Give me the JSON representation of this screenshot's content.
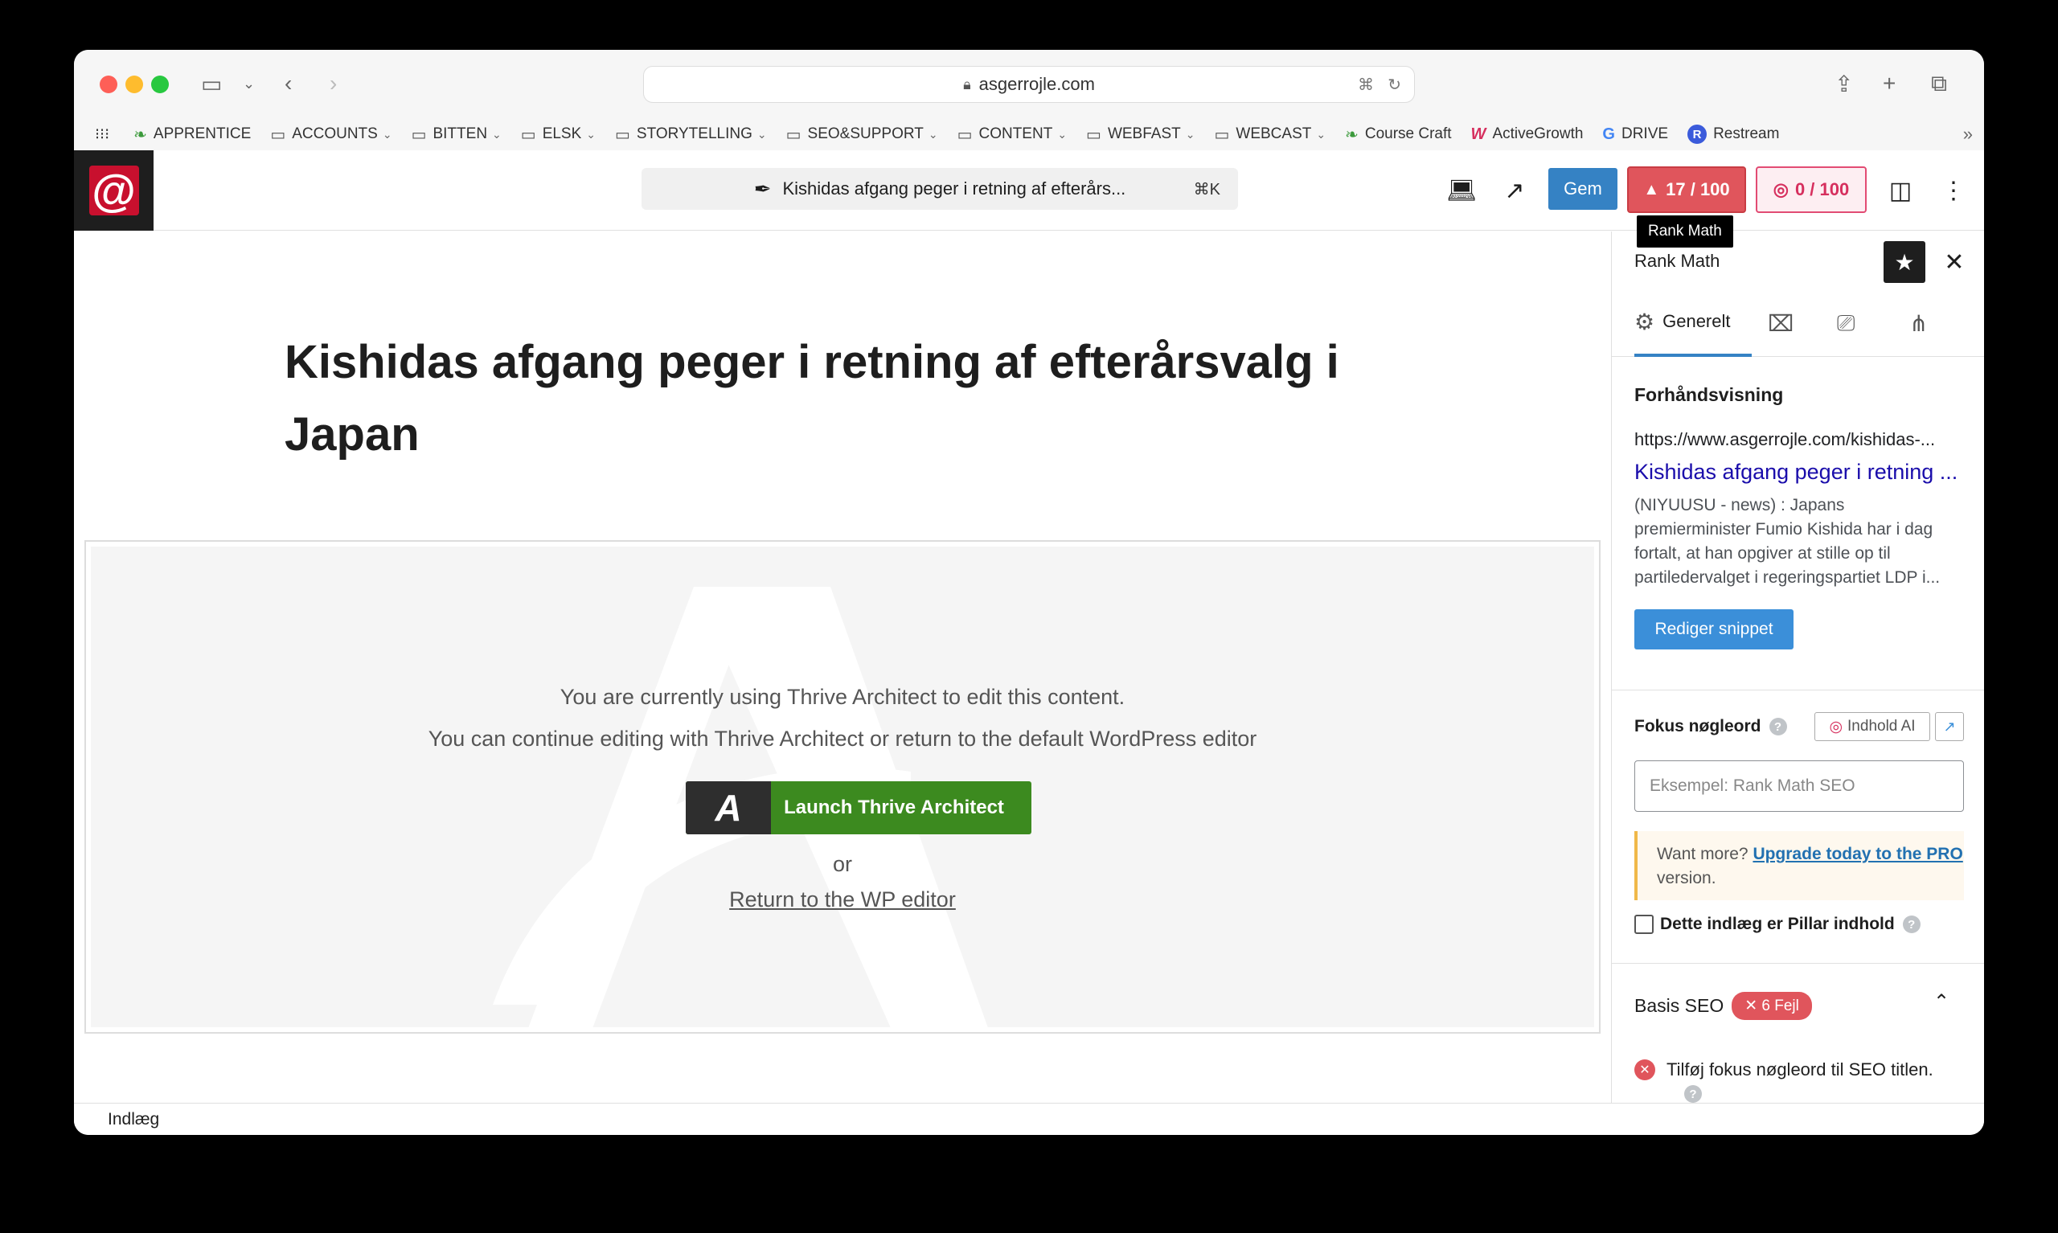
{
  "browser": {
    "url": "asgerrojle.com",
    "bookmarks": [
      {
        "label": "APPRENTICE",
        "icon": "leaf-icon",
        "folder": false
      },
      {
        "label": "ACCOUNTS",
        "icon": "folder-icon",
        "folder": true
      },
      {
        "label": "BITTEN",
        "icon": "folder-icon",
        "folder": true
      },
      {
        "label": "ELSK",
        "icon": "folder-icon",
        "folder": true
      },
      {
        "label": "STORYTELLING",
        "icon": "folder-icon",
        "folder": true
      },
      {
        "label": "SEO&SUPPORT",
        "icon": "folder-icon",
        "folder": true
      },
      {
        "label": "CONTENT",
        "icon": "folder-icon",
        "folder": true
      },
      {
        "label": "WEBFAST",
        "icon": "folder-icon",
        "folder": true
      },
      {
        "label": "WEBCAST",
        "icon": "folder-icon",
        "folder": true
      },
      {
        "label": "Course Craft",
        "icon": "leaf-icon",
        "folder": false
      },
      {
        "label": "ActiveGrowth",
        "icon": "w-icon",
        "folder": false
      },
      {
        "label": "DRIVE",
        "icon": "google-icon",
        "folder": false
      },
      {
        "label": "Restream",
        "icon": "restream-icon",
        "folder": false
      }
    ]
  },
  "wp": {
    "command_title": "Kishidas afgang peger i retning af efterårs...",
    "command_shortcut": "⌘K",
    "save_label": "Gem",
    "seo_score": "17 / 100",
    "content_ai_score": "0 / 100",
    "tooltip": "Rank Math"
  },
  "post": {
    "title": "Kishidas afgang peger i retning af efterårsvalg i Japan"
  },
  "thrive": {
    "line1": "You are currently using Thrive Architect to edit this content.",
    "line2": "You can continue editing with Thrive Architect or return to the default WordPress editor",
    "launch_label": "Launch Thrive Architect",
    "or": "or",
    "return_link": "Return to the WP editor"
  },
  "sidebar": {
    "title": "Rank Math",
    "tab_general": "Generelt",
    "preview_heading": "Forhåndsvisning",
    "snippet_url": "https://www.asgerrojle.com/kishidas-...",
    "snippet_title": "Kishidas afgang peger i retning ...",
    "snippet_desc": "(NIYUUSU - news) : Japans premierminister Fumio Kishida har i dag fortalt, at han opgiver at stille op til partiledervalget i regeringspartiet LDP i...",
    "edit_snippet": "Rediger snippet",
    "focus_label": "Fokus nøgleord",
    "ai_button": "Indhold AI",
    "keyword_placeholder": "Eksempel: Rank Math SEO",
    "pro_prefix": "Want more? ",
    "pro_link": "Upgrade today to the PRO",
    "pro_suffix": " version.",
    "pillar_label": "Dette indlæg er Pillar indhold",
    "basis_label": "Basis SEO",
    "errors_badge": "✕ 6 Fejl",
    "check_1": "Tilføj fokus nøgleord til SEO titlen."
  },
  "footer": {
    "breadcrumb": "Indlæg"
  },
  "colors": {
    "rank_red": "#e0555c",
    "wp_blue": "#3582c4",
    "thrive_green": "#3c8a1f"
  }
}
